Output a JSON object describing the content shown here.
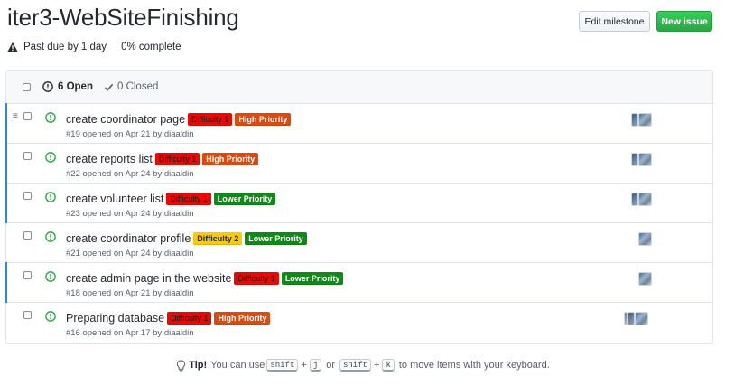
{
  "milestone": {
    "title": "iter3-WebSiteFinishing",
    "due_status": "Past due by 1 day",
    "progress": "0% complete",
    "progress_fraction": 0
  },
  "actions": {
    "edit_label": "Edit milestone",
    "new_label": "New issue"
  },
  "states": {
    "open": "6 Open",
    "closed": "0 Closed"
  },
  "colors": {
    "accent_blue": "#2188ff",
    "open_green": "#28a745",
    "difficulty_1": "#ee0701",
    "difficulty_2": "#fbca04",
    "high_priority": "#e2480a",
    "lower_priority": "#0e8a16"
  },
  "issues": [
    {
      "title": "create coordinator page",
      "sub": "#19 opened on Apr 21 by diaaldin",
      "label1": "Difficulty 1",
      "label2": "High Priority"
    },
    {
      "title": "create reports list",
      "sub": "#22 opened on Apr 24 by diaaldin",
      "label1": "Difficulty 1",
      "label2": "High Priority"
    },
    {
      "title": "create volunteer list",
      "sub": "#23 opened on Apr 24 by diaaldin",
      "label1": "Difficulty 1",
      "label2": "Lower Priority"
    },
    {
      "title": "create coordinator profile",
      "sub": "#21 opened on Apr 24 by diaaldin",
      "label1": "Difficulty 2",
      "label2": "Lower Priority"
    },
    {
      "title": "create admin page in the website",
      "sub": "#18 opened on Apr 21 by diaaldin",
      "label1": "Difficulty 1",
      "label2": "Lower Priority"
    },
    {
      "title": "Preparing database",
      "sub": "#16 opened on Apr 17 by diaaldin",
      "label1": "Difficulty 1",
      "label2": "High Priority"
    }
  ],
  "tip": {
    "bold": "Tip!",
    "text1": "You can use",
    "key_shift": "shift",
    "key_j": "j",
    "or": "or",
    "key_k": "k",
    "text2": "to move items with your keyboard."
  }
}
